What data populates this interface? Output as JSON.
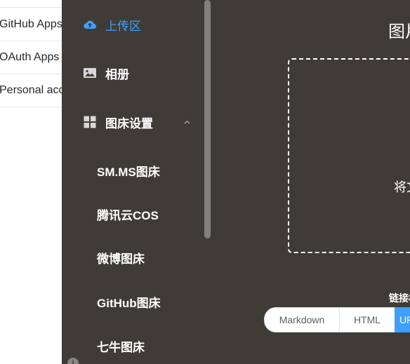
{
  "background_page": {
    "links": [
      "GitHub Apps",
      "OAuth Apps",
      "Personal access tokens"
    ]
  },
  "sidebar": {
    "items": [
      {
        "label": "上传区",
        "icon": "cloud-upload-icon",
        "active": true
      },
      {
        "label": "相册",
        "icon": "image-icon",
        "active": false
      },
      {
        "label": "图床设置",
        "icon": "grid-icon",
        "expanded": true
      }
    ],
    "sub_items": [
      "SM.MS图床",
      "腾讯云COS",
      "微博图床",
      "GitHub图床",
      "七牛图床"
    ]
  },
  "main": {
    "title": "图片上传",
    "drop_text": "将文件拖到此处，或点击上传",
    "link_format_label": "链接格式",
    "formats": [
      "Markdown",
      "HTML",
      "URL"
    ],
    "selected_format": "URL"
  },
  "colors": {
    "sidebar_bg": "#3f3c37",
    "accent": "#409eff",
    "text": "#ffffff"
  }
}
